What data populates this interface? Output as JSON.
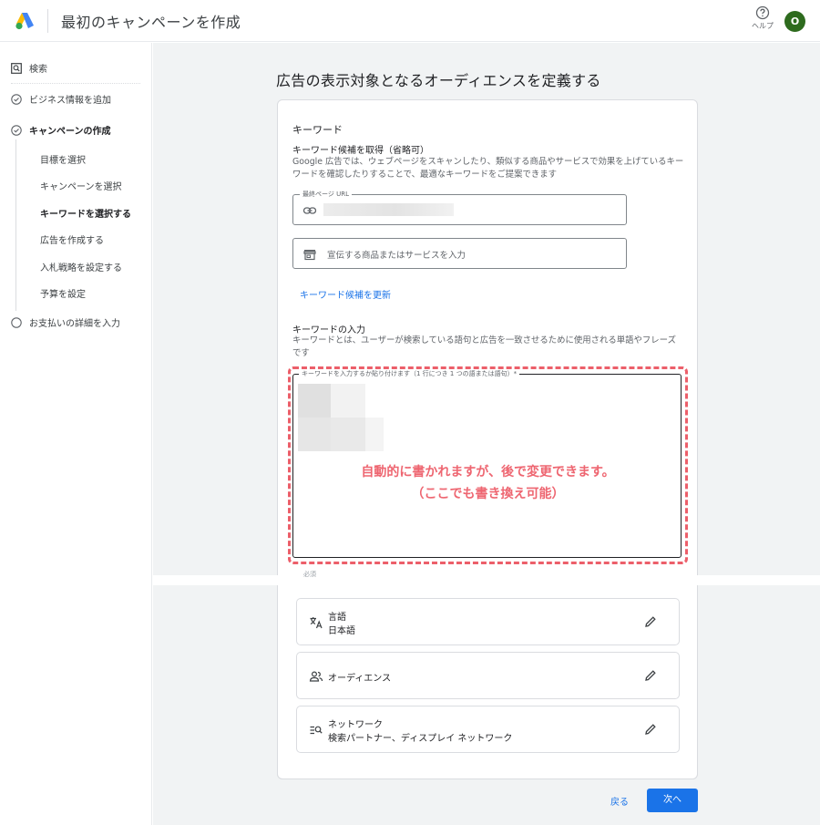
{
  "header": {
    "title": "最初のキャンペーンを作成",
    "help_label": "ヘルプ",
    "avatar_letter": "O",
    "avatar_color": "#2e6b1e"
  },
  "sidebar": {
    "search_label": "検索",
    "steps": [
      {
        "label": "ビジネス情報を追加",
        "state": "done"
      },
      {
        "label": "キャンペーンの作成",
        "state": "current"
      },
      {
        "label": "お支払いの詳細を入力",
        "state": "pending"
      }
    ],
    "substeps": [
      {
        "label": "目標を選択"
      },
      {
        "label": "キャンペーンを選択"
      },
      {
        "label": "キーワードを選択する",
        "active": true
      },
      {
        "label": "広告を作成する"
      },
      {
        "label": "入札戦略を設定する"
      },
      {
        "label": "予算を設定"
      }
    ]
  },
  "main": {
    "heading": "広告の表示対象となるオーディエンスを定義する",
    "keywords": {
      "title": "キーワード",
      "suggest_title": "キーワード候補を取得（省略可）",
      "suggest_desc": "Google 広告では、ウェブページをスキャンしたり、類似する商品やサービスで効果を上げているキーワードを確認したりすることで、最適なキーワードをご提案できます",
      "url_label": "最終ページ URL",
      "url_value": "",
      "product_placeholder": "宣伝する商品またはサービスを入力",
      "refresh_link": "キーワード候補を更新",
      "input_title": "キーワードの入力",
      "input_desc": "キーワードとは、ユーザーが検索している語句と広告を一致させるために使用される単語やフレーズです",
      "textarea_label": "キーワードを入力するか貼り付けます（1 行につき 1 つの語または語句）*",
      "annotation_line1": "自動的に書かれますが、後で変更できます。",
      "annotation_line2": "（ここでも書き換え可能）",
      "annotation_color": "#ee6671",
      "required_note": "必須"
    },
    "settings": [
      {
        "icon": "translate-icon",
        "label": "言語",
        "value": "日本語"
      },
      {
        "icon": "people-icon",
        "label": "オーディエンス",
        "value": ""
      },
      {
        "icon": "network-icon",
        "label": "ネットワーク",
        "value": "検索パートナー、ディスプレイ ネットワーク"
      }
    ],
    "back_label": "戻る",
    "next_label": "次へ",
    "accent_color": "#1a73e8"
  }
}
